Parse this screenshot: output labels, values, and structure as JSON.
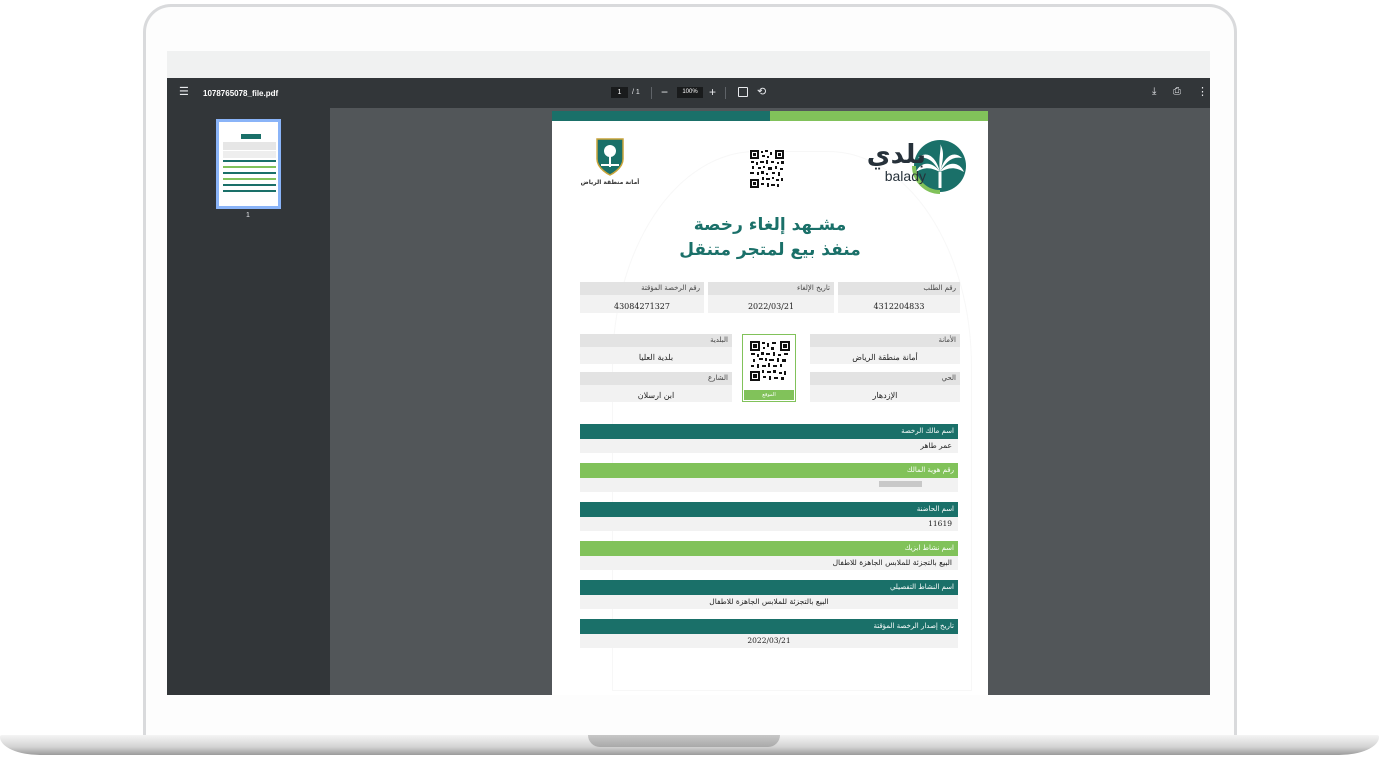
{
  "viewer": {
    "filename": "1078765078_file.pdf",
    "page_current": "1",
    "page_total": "/ 1",
    "zoom": "100%",
    "thumbnail_label": "1"
  },
  "document": {
    "logo_ar": "بلدي",
    "logo_en": "balady",
    "amana_label": "أمانة منطقة الرياض",
    "title_line1": "مشـهد إلغاء رخصة",
    "title_line2": "منفذ بيع لمتجر متنقل",
    "request_number_label": "رقم الطلب",
    "request_number": "4312204833",
    "cancel_date_label": "تاريخ الإلغاء",
    "cancel_date": "2022/03/21",
    "temp_license_label": "رقم الرخصة المؤقتة",
    "temp_license": "43084271327",
    "amana_field_label": "الأمانة",
    "amana_field": "أمانة منطقة الرياض",
    "municipality_label": "البلدية",
    "municipality": "بلدية العليا",
    "district_label": "الحي",
    "district": "الإزدهار",
    "street_label": "الشارع",
    "street": "ابن ارسلان",
    "qr_button": "الموقع",
    "owner_name_label": "اسم مالك الرخصة",
    "owner_name": "عمر طاهر",
    "owner_id_label": "رقم هوية المالك",
    "incubator_label": "اسم الحاضنة",
    "incubator": "11619",
    "main_activity_label": "اسم نشاط ابزيك",
    "main_activity": "البيع بالتجزئة للملابس الجاهزة للاطفال",
    "detailed_activity_label": "اسم النشاط التفصيلي",
    "detailed_activity": "البيع بالتجزئة للملابس الجاهزة للاطفال",
    "issue_date_label": "تاريخ إصدار الرخصة المؤقتة",
    "issue_date": "2022/03/21"
  },
  "colors": {
    "dark_teal": "#1a7069",
    "light_green": "#81c25a",
    "toolbar": "#323639",
    "viewer_bg": "#525659"
  }
}
